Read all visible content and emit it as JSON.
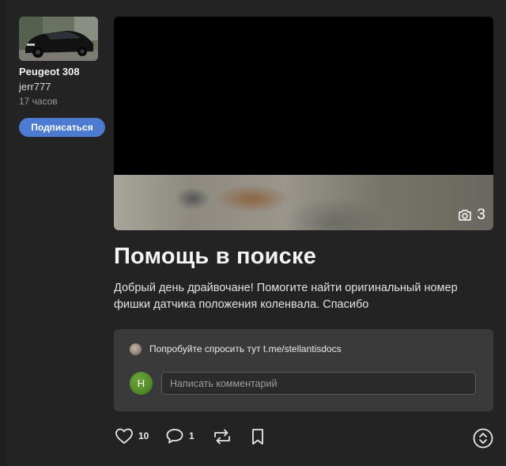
{
  "author": {
    "car": "Peugeot 308",
    "username": "jerr777",
    "time": "17 часов",
    "subscribe_label": "Подписаться"
  },
  "media": {
    "photo_count": "3",
    "icon": "camera-icon"
  },
  "post": {
    "title": "Помощь в поиске",
    "text": "Добрый день драйвочане! Помогите найти оригинальный номер фишки датчика положения коленвала. Спасибо"
  },
  "comments": {
    "latest_text": "Попробуйте спросить тут t.me/stellantisdocs",
    "my_avatar_letter": "Н",
    "input_placeholder": "Написать комментарий"
  },
  "actions": {
    "likes": "10",
    "comments": "1",
    "icons": [
      "heart-icon",
      "comment-icon",
      "repost-icon",
      "bookmark-icon",
      "scroll-toggle-icon"
    ]
  },
  "colors": {
    "background": "#202020",
    "accent": "#4d7bd1",
    "comment_box": "#3a3a3a"
  }
}
